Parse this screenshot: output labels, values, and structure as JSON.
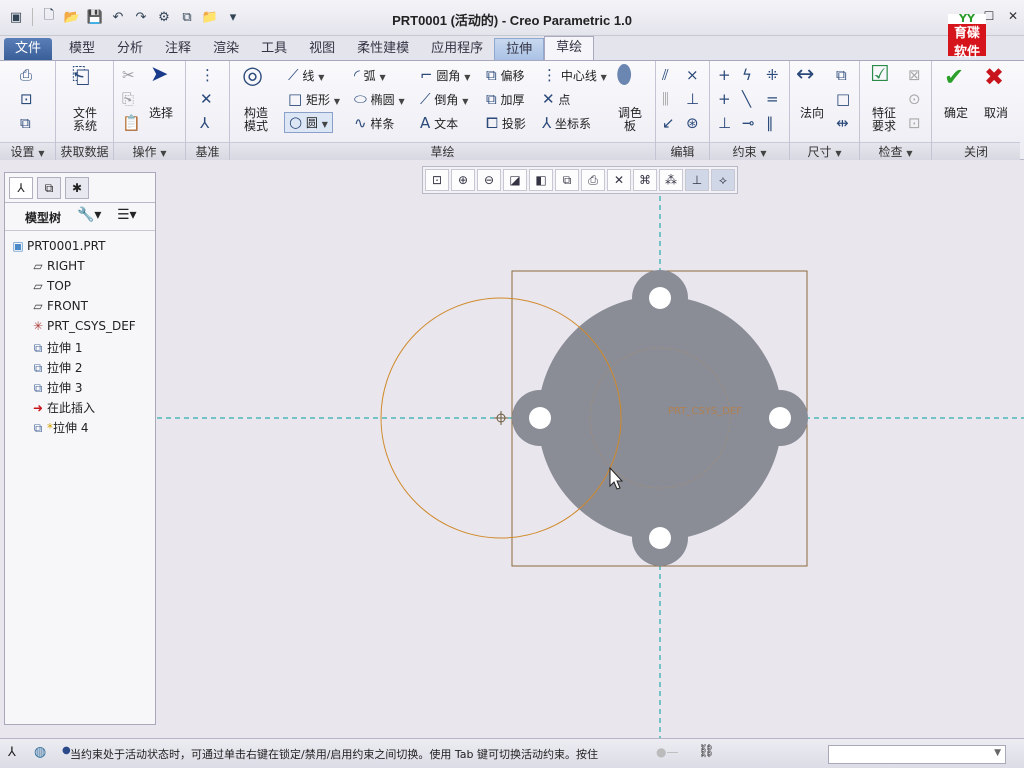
{
  "window": {
    "title": "PRT0001 (活动的) - Creo Parametric 1.0"
  },
  "logo": {
    "top": "YY",
    "text": "育碟软件"
  },
  "tabs": [
    "文件",
    "模型",
    "分析",
    "注释",
    "渲染",
    "工具",
    "视图",
    "柔性建模",
    "应用程序",
    "拉伸",
    "草绘"
  ],
  "ribbon": {
    "groups": {
      "setup": "设置",
      "getdata": "获取数据",
      "ops": "操作",
      "datum": "基准",
      "sketch": "草绘",
      "edit": "编辑",
      "constrain": "约束",
      "dimension": "尺寸",
      "inspect": "检查",
      "close": "关闭"
    },
    "file_system": "文件\n系统",
    "select": "选择",
    "construct_mode": "构造\n模式",
    "palette": "调色\n板",
    "normal": "法向",
    "feature_req": "特征\n要求",
    "ok": "确定",
    "cancel": "取消",
    "sketch_tools": {
      "line": "线",
      "arc": "弧",
      "fillet": "圆角",
      "offset": "偏移",
      "centerline": "中心线",
      "rectangle": "矩形",
      "ellipse": "椭圆",
      "chamfer": "倒角",
      "thicken": "加厚",
      "point": "点",
      "circle": "圆",
      "spline": "样条",
      "text": "文本",
      "project": "投影",
      "coordsys": "坐标系"
    }
  },
  "model_tree": {
    "title": "模型树",
    "nodes": [
      {
        "label": "PRT0001.PRT",
        "icon": "part-icon"
      },
      {
        "label": "RIGHT",
        "icon": "datum-plane-icon"
      },
      {
        "label": "TOP",
        "icon": "datum-plane-icon"
      },
      {
        "label": "FRONT",
        "icon": "datum-plane-icon"
      },
      {
        "label": "PRT_CSYS_DEF",
        "icon": "csys-icon"
      },
      {
        "label": "拉伸 1",
        "icon": "extrude-icon"
      },
      {
        "label": "拉伸 2",
        "icon": "extrude-icon"
      },
      {
        "label": "拉伸 3",
        "icon": "extrude-icon"
      },
      {
        "label": "在此插入",
        "icon": "insert-here-icon"
      },
      {
        "label": "拉伸 4",
        "icon": "extrude-new-icon"
      }
    ]
  },
  "canvas": {
    "csys_label": "PRT_CSYS_DEF"
  },
  "status": {
    "message": "当约束处于活动状态时，可通过单击右键在锁定/禁用/启用约束之间切换。使用 Tab 键可切换活动约束。按住"
  },
  "colors": {
    "part_fill": "#8a8c96",
    "sketch": "#d08a2a",
    "axis": "#00a0a0",
    "accent_blue": "#3a5f98"
  }
}
